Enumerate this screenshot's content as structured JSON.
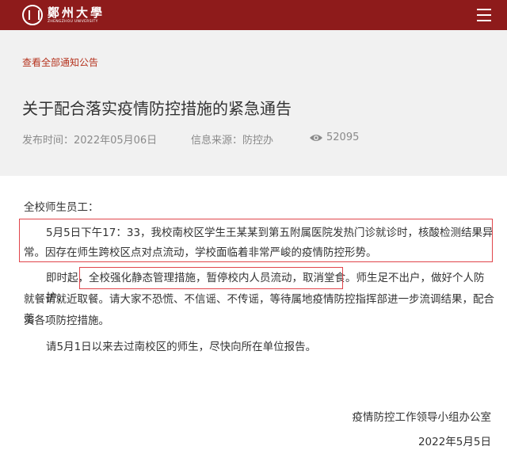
{
  "header": {
    "logo_cn": "鄭州大學",
    "logo_en": "ZHENGZHOU UNIVERSITY",
    "menu_icon": "hamburger-menu-icon"
  },
  "notice": {
    "back_link": "查看全部通知公告",
    "title": "关于配合落实疫情防控措施的紧急通告",
    "publish_time": "发布时间：2022年05月06日",
    "source": "信息来源：防控办",
    "views": "52095",
    "views_icon": "eye-icon"
  },
  "body": {
    "salutation": "全校师生员工：",
    "p1_line1": "5月5日下午17：33，我校南校区学生王某某到第五附属医院发热门诊就诊时，核酸检测结果异",
    "p1_line2": "常。因存在师生跨校区点对点流动，学校面临着非常严峻的疫情防控形势。",
    "p2_pre": "即时起，",
    "p2_highlight": "全校强化静态管理措施，暂停校内人员流动，取消堂食。",
    "p2_post": "师生足不出户，做好个人防护，",
    "p2_line2": "就餐请就近取餐。请大家不恐慌、不信谣、不传谣，等待属地疫情防控指挥部进一步流调结果，配合落",
    "p2_line3": "实各项防控措施。",
    "p3": "请5月1日以来去过南校区的师生，尽快向所在单位报告。"
  },
  "signature": {
    "office": "疫情防控工作领导小组办公室",
    "date": "2022年5月5日"
  },
  "colors": {
    "brand": "#8e1b1b",
    "link": "#b5331e",
    "highlight_border": "#e0454b"
  }
}
